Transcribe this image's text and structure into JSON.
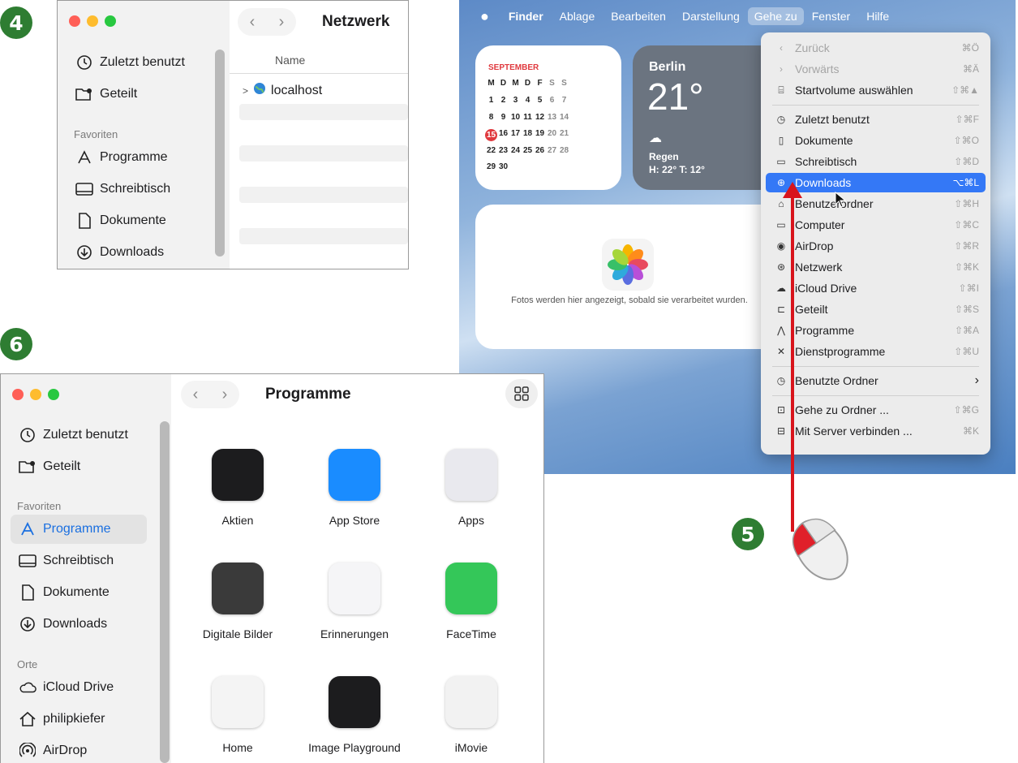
{
  "steps": {
    "four": "4",
    "five": "5",
    "six": "6"
  },
  "window4": {
    "title": "Netzwerk",
    "sidebar": [
      {
        "label": "Zuletzt benutzt",
        "icon": "clock-icon"
      },
      {
        "label": "Geteilt",
        "icon": "shared-folder-icon"
      }
    ],
    "favorites_heading": "Favoriten",
    "favorites": [
      {
        "label": "Programme",
        "icon": "apps-icon"
      },
      {
        "label": "Schreibtisch",
        "icon": "desktop-icon"
      },
      {
        "label": "Dokumente",
        "icon": "document-icon"
      },
      {
        "label": "Downloads",
        "icon": "download-icon"
      }
    ],
    "column_header": "Name",
    "rows": [
      {
        "label": "localhost",
        "icon": "globe-icon"
      }
    ]
  },
  "desktop": {
    "menubar": [
      "Finder",
      "Ablage",
      "Bearbeiten",
      "Darstellung",
      "Gehe zu",
      "Fenster",
      "Hilfe"
    ],
    "calendar": {
      "month": "SEPTEMBER",
      "weekdays": [
        "M",
        "D",
        "M",
        "D",
        "F",
        "S",
        "S"
      ],
      "weeks": [
        [
          "1",
          "2",
          "3",
          "4",
          "5",
          "6",
          "7"
        ],
        [
          "8",
          "9",
          "10",
          "11",
          "12",
          "13",
          "14"
        ],
        [
          "15",
          "16",
          "17",
          "18",
          "19",
          "20",
          "21"
        ],
        [
          "22",
          "23",
          "24",
          "25",
          "26",
          "27",
          "28"
        ],
        [
          "29",
          "30",
          "",
          "",
          "",
          "",
          ""
        ]
      ],
      "today": "15"
    },
    "weather": {
      "city": "Berlin",
      "temp": "21°",
      "condition": "Regen",
      "range": "H: 22° T: 12°"
    },
    "photos": {
      "message": "Fotos werden hier angezeigt, sobald sie verarbeitet wurden."
    },
    "menu": [
      {
        "label": "Zurück",
        "icon": "‹",
        "key": "⌘Ö",
        "dim": true
      },
      {
        "label": "Vorwärts",
        "icon": "›",
        "key": "⌘Ä",
        "dim": true
      },
      {
        "label": "Startvolume auswählen",
        "icon": "⌸",
        "key": "⇧⌘▲"
      },
      {
        "sep": true
      },
      {
        "label": "Zuletzt benutzt",
        "icon": "◷",
        "key": "⇧⌘F"
      },
      {
        "label": "Dokumente",
        "icon": "▯",
        "key": "⇧⌘O"
      },
      {
        "label": "Schreibtisch",
        "icon": "▭",
        "key": "⇧⌘D"
      },
      {
        "label": "Downloads",
        "icon": "⊕",
        "key": "⌥⌘L",
        "highlight": true
      },
      {
        "label": "Benutzerordner",
        "icon": "⌂",
        "key": "⇧⌘H"
      },
      {
        "label": "Computer",
        "icon": "▭",
        "key": "⇧⌘C"
      },
      {
        "label": "AirDrop",
        "icon": "◉",
        "key": "⇧⌘R"
      },
      {
        "label": "Netzwerk",
        "icon": "⊛",
        "key": "⇧⌘K"
      },
      {
        "label": "iCloud Drive",
        "icon": "☁",
        "key": "⇧⌘I"
      },
      {
        "label": "Geteilt",
        "icon": "⊏",
        "key": "⇧⌘S"
      },
      {
        "label": "Programme",
        "icon": "⋀",
        "key": "⇧⌘A"
      },
      {
        "label": "Dienstprogramme",
        "icon": "✕",
        "key": "⇧⌘U"
      },
      {
        "sep": true
      },
      {
        "label": "Benutzte Ordner",
        "icon": "◷",
        "key": "›"
      },
      {
        "sep": true
      },
      {
        "label": "Gehe zu Ordner ...",
        "icon": "⊡",
        "key": "⇧⌘G"
      },
      {
        "label": "Mit Server verbinden ...",
        "icon": "⊟",
        "key": "⌘K"
      }
    ]
  },
  "window6": {
    "title": "Programme",
    "sidebar": [
      {
        "label": "Zuletzt benutzt",
        "icon": "clock-icon"
      },
      {
        "label": "Geteilt",
        "icon": "shared-folder-icon"
      }
    ],
    "favorites_heading": "Favoriten",
    "favorites": [
      {
        "label": "Programme",
        "icon": "apps-icon",
        "active": true
      },
      {
        "label": "Schreibtisch",
        "icon": "desktop-icon"
      },
      {
        "label": "Dokumente",
        "icon": "document-icon"
      },
      {
        "label": "Downloads",
        "icon": "download-icon"
      }
    ],
    "places_heading": "Orte",
    "places": [
      {
        "label": "iCloud Drive",
        "icon": "cloud-icon"
      },
      {
        "label": "philipkiefer",
        "icon": "home-icon"
      },
      {
        "label": "AirDrop",
        "icon": "airdrop-icon"
      }
    ],
    "apps": [
      {
        "label": "Aktien",
        "color": "#1c1c1e"
      },
      {
        "label": "App Store",
        "color": "#1a8cff"
      },
      {
        "label": "Apps",
        "color": "#e9e9ee"
      },
      {
        "label": "Digitale Bilder",
        "color": "#3a3a3a"
      },
      {
        "label": "Erinnerungen",
        "color": "#f5f5f7"
      },
      {
        "label": "FaceTime",
        "color": "#34c759"
      },
      {
        "label": "Home",
        "color": "#f4f4f4"
      },
      {
        "label": "Image Playground",
        "color": "#1c1c1e"
      },
      {
        "label": "iMovie",
        "color": "#f2f2f2"
      }
    ]
  }
}
